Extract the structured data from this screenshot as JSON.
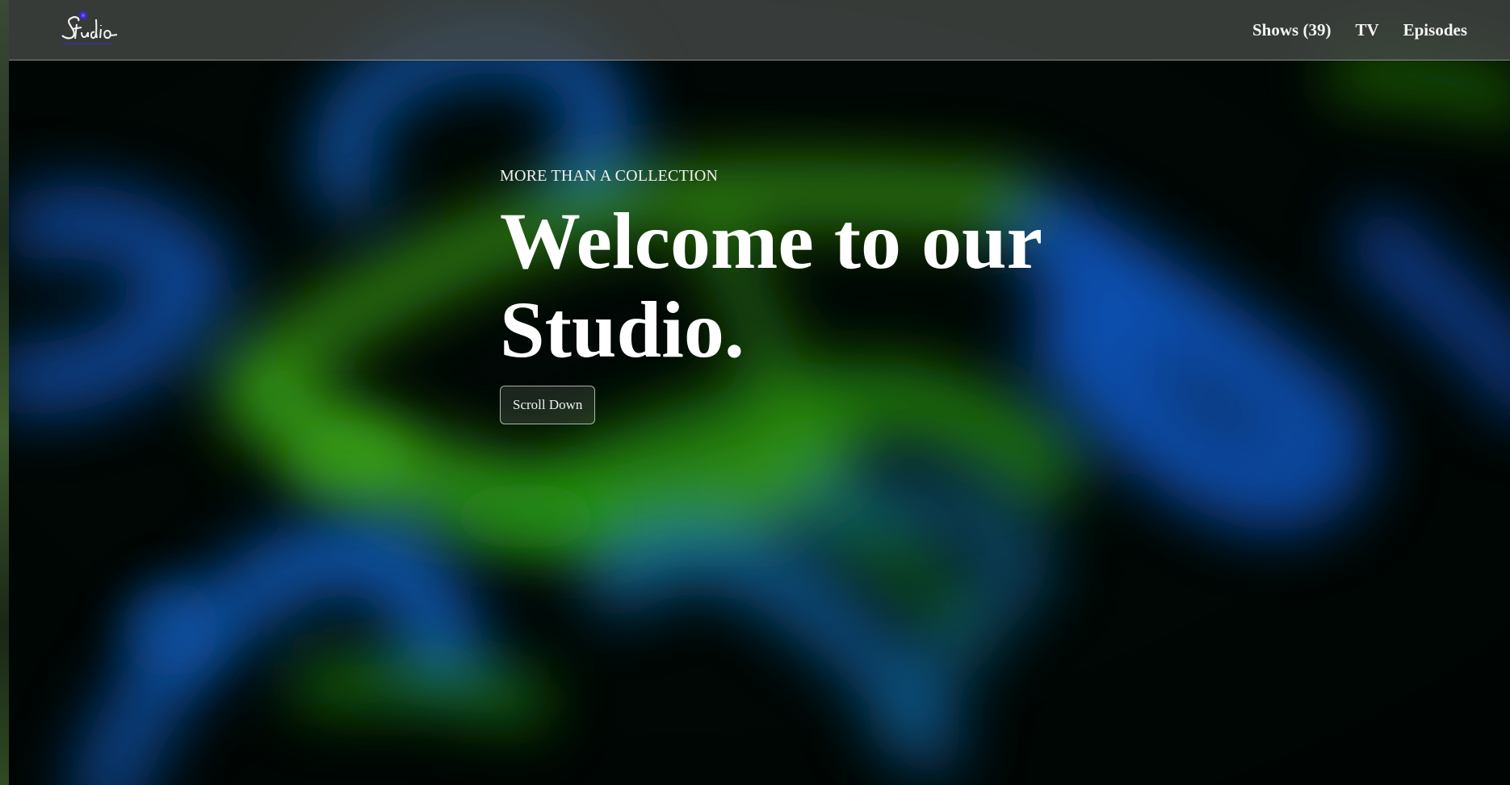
{
  "nav": {
    "logo_text": "Studio",
    "links": [
      {
        "label": "Shows (39)"
      },
      {
        "label": "TV"
      },
      {
        "label": "Episodes"
      }
    ]
  },
  "hero": {
    "eyebrow": "MORE THAN A COLLECTION",
    "headline_line1": "Welcome to our",
    "headline_line2": "Studio.",
    "cta_label": "Scroll Down"
  },
  "colors": {
    "nav_bg": "#464a48",
    "logo_dot": "#3b2bd6",
    "glow_green": "#2ea012",
    "glow_blue": "#0a6ad0",
    "text": "#ffffff"
  },
  "icons": {
    "logo": "studio-script-logo-icon"
  }
}
